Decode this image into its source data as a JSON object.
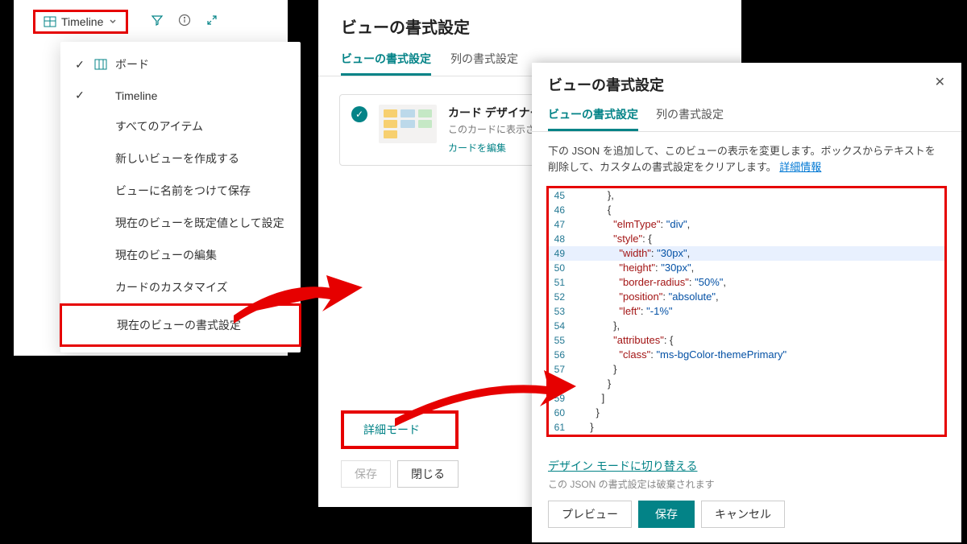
{
  "panel1": {
    "view_button": "Timeline",
    "dropdown": {
      "board": "ボード",
      "timeline": "Timeline",
      "all_items": "すべてのアイテム",
      "create_view": "新しいビューを作成する",
      "save_as": "ビューに名前をつけて保存",
      "set_default": "現在のビューを既定値として設定",
      "edit_view": "現在のビューの編集",
      "customize_card": "カードのカスタマイズ",
      "format_view": "現在のビューの書式設定"
    }
  },
  "panel2": {
    "title": "ビューの書式設定",
    "tab_view": "ビューの書式設定",
    "tab_col": "列の書式設定",
    "card_designer": {
      "title": "カード デザイナー",
      "subtitle": "このカードに表示される",
      "link": "カードを編集"
    },
    "adv_link": "詳細モード",
    "save": "保存",
    "close": "閉じる"
  },
  "panel3": {
    "title": "ビューの書式設定",
    "tab_view": "ビューの書式設定",
    "tab_col": "列の書式設定",
    "desc_pre": "下の JSON を追加して、このビューの表示を変更します。ボックスからテキストを削除して、カスタムの書式設定をクリアします。",
    "learn_more": "詳細情報",
    "code": {
      "lines": [
        {
          "n": "45",
          "t": "        },"
        },
        {
          "n": "46",
          "t": "        {"
        },
        {
          "n": "47",
          "t": "          \"elmType\": \"div\",",
          "tokens": [
            [
              "prop",
              "\"elmType\""
            ],
            [
              "",
              ":"
            ],
            [
              "",
              ":"
            ]
          ]
        },
        {
          "n": "48",
          "t": "          \"style\": {"
        },
        {
          "n": "49",
          "t": "            \"width\": \"30px\","
        },
        {
          "n": "50",
          "t": "            \"height\": \"30px\","
        },
        {
          "n": "51",
          "t": "            \"border-radius\": \"50%\","
        },
        {
          "n": "52",
          "t": "            \"position\": \"absolute\","
        },
        {
          "n": "53",
          "t": "            \"left\": \"-1%\""
        },
        {
          "n": "54",
          "t": "          },"
        },
        {
          "n": "55",
          "t": "          \"attributes\": {"
        },
        {
          "n": "56",
          "t": "            \"class\": \"ms-bgColor-themePrimary\""
        },
        {
          "n": "57",
          "t": "          }"
        },
        {
          "n": "58",
          "t": "        }"
        },
        {
          "n": "59",
          "t": "      ]"
        },
        {
          "n": "60",
          "t": "    }"
        },
        {
          "n": "61",
          "t": "  }"
        }
      ]
    },
    "design_link": "デザイン モードに切り替える",
    "design_note": "この JSON の書式設定は破棄されます",
    "preview": "プレビュー",
    "save": "保存",
    "cancel": "キャンセル"
  }
}
